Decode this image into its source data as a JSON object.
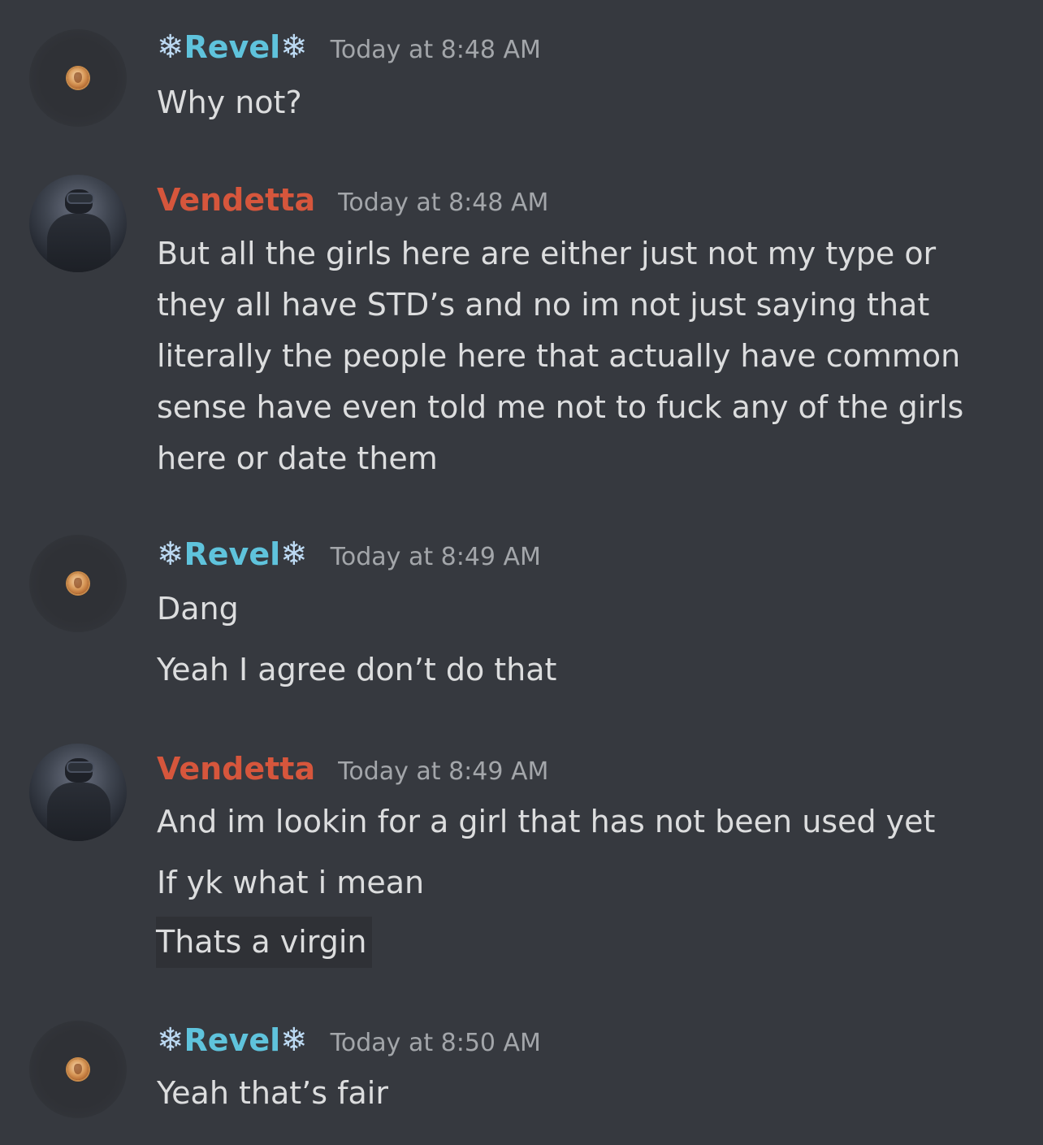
{
  "messages": [
    {
      "author": "Revel",
      "decor_icon": "snowflake-icon",
      "timestamp": "Today at 8:48 AM",
      "lines": [
        "Why not?"
      ]
    },
    {
      "author": "Vendetta",
      "timestamp": "Today at 8:48 AM",
      "lines": [
        "But all the girls here are either just not my type or",
        "they all have STD’s and no im not just saying that",
        "literally the people here that actually have common",
        "sense have even told me not to fuck any of the girls",
        "here or date them"
      ]
    },
    {
      "author": "Revel",
      "decor_icon": "snowflake-icon",
      "timestamp": "Today at 8:49 AM",
      "lines": [
        "Dang",
        "Yeah I agree don’t do that"
      ]
    },
    {
      "author": "Vendetta",
      "timestamp": "Today at 8:49 AM",
      "lines": [
        "And im lookin for a girl that has not been used yet",
        "If yk what i mean",
        "Thats a virgin"
      ]
    },
    {
      "author": "Revel",
      "decor_icon": "snowflake-icon",
      "timestamp": "Today at 8:50 AM",
      "lines": [
        "Yeah that’s fair"
      ]
    }
  ],
  "colors": {
    "background": "#36393f",
    "revel_name": "#5fc3dc",
    "vendetta_name": "#d6563c",
    "timestamp": "#a3a6aa",
    "message_text": "#dcddde",
    "highlight_bg": "#2f3136"
  }
}
